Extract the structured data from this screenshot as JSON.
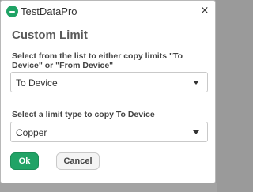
{
  "window": {
    "app_title": "TestDataPro",
    "close_glyph": "×",
    "logo_icon": "testdatapro-logo-icon"
  },
  "dialog": {
    "heading": "Custom Limit",
    "copy_direction": {
      "label": "Select from the list to either copy limits \"To Device\" or \"From Device\"",
      "selected": "To Device"
    },
    "limit_type": {
      "label": "Select a limit type to copy To Device",
      "selected": "Copper"
    },
    "buttons": {
      "ok": "Ok",
      "cancel": "Cancel"
    }
  },
  "colors": {
    "accent": "#21a366",
    "backdrop": "#9a9a9a"
  }
}
